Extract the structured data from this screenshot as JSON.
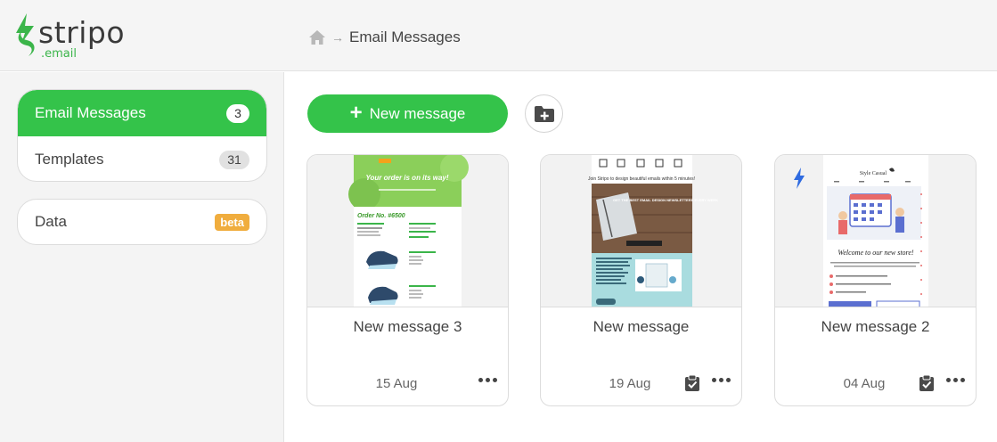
{
  "brand": {
    "name": "stripo",
    "suffix": ".email",
    "accent": "#34c34a"
  },
  "breadcrumb": {
    "current": "Email Messages"
  },
  "sidebar": {
    "items": [
      {
        "label": "Email Messages",
        "count": "3",
        "active": true
      },
      {
        "label": "Templates",
        "count": "31",
        "active": false
      }
    ],
    "data_item": {
      "label": "Data",
      "badge": "beta"
    }
  },
  "toolbar": {
    "new_message_label": "New message"
  },
  "cards": [
    {
      "title": "New message 3",
      "date": "15 Aug",
      "thumb_title": "Your order is on its way!",
      "thumb_order": "Order No. #6500"
    },
    {
      "title": "New message",
      "date": "19 Aug",
      "thumb_title": "Join Stripo to design beautiful emails within 5 minutes!",
      "thumb_sub": "GET THE BEST EMAIL DESIGN NEWSLETTERS EVERY WEEK"
    },
    {
      "title": "New message 2",
      "date": "04 Aug",
      "thumb_title": "Welcome to our new store!",
      "thumb_brand": "Style Casual"
    }
  ]
}
